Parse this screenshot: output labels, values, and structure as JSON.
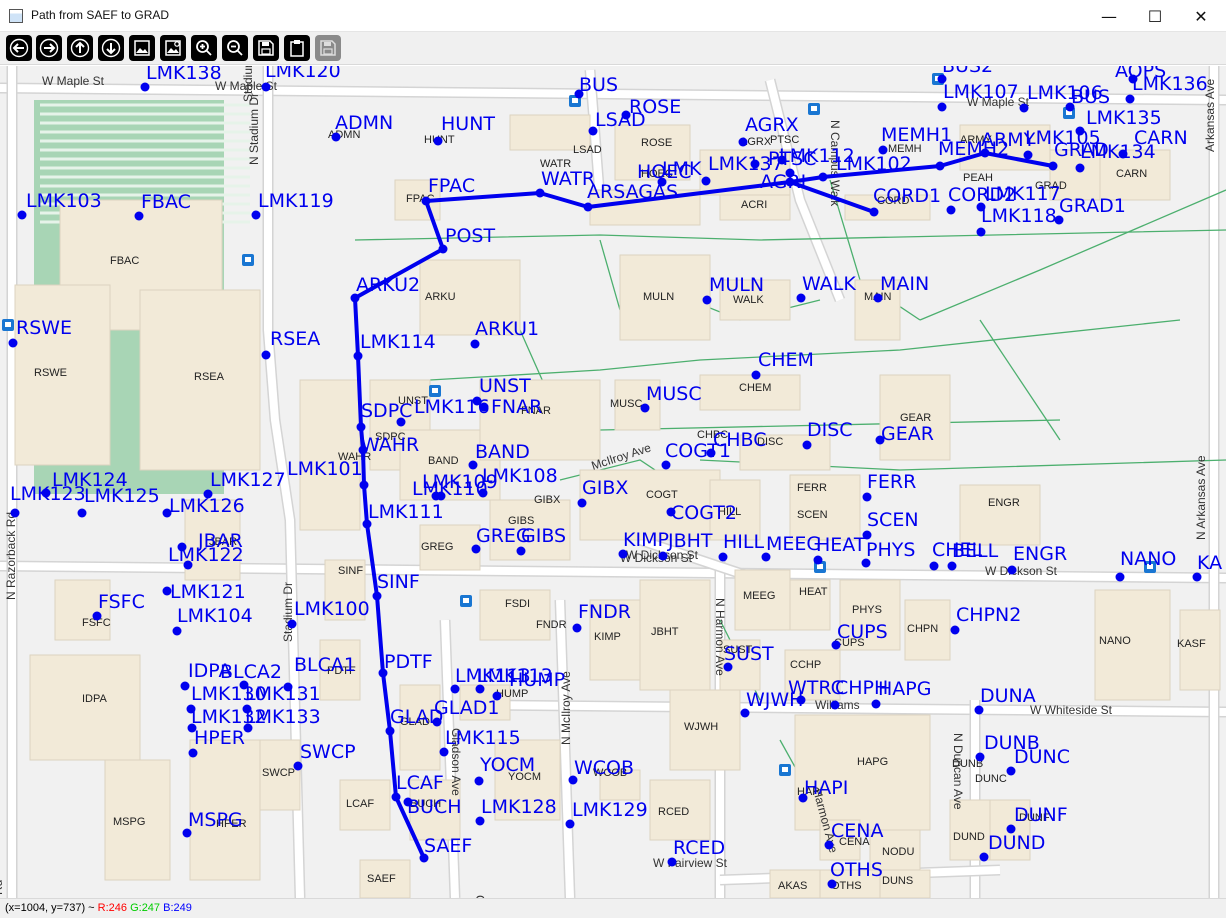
{
  "window": {
    "title": "Path from SAEF to GRAD",
    "minimize_glyph": "—",
    "maximize_glyph": "☐",
    "close_glyph": "✕"
  },
  "toolbar": [
    {
      "name": "back-button",
      "icon": "arrow-left-icon",
      "enabled": true
    },
    {
      "name": "forward-button",
      "icon": "arrow-right-icon",
      "enabled": true
    },
    {
      "name": "up-button",
      "icon": "arrow-up-icon",
      "enabled": true
    },
    {
      "name": "down-button",
      "icon": "arrow-down-icon",
      "enabled": true
    },
    {
      "name": "image-button",
      "icon": "image-icon",
      "enabled": true
    },
    {
      "name": "image-edit-button",
      "icon": "image-gear-icon",
      "enabled": true
    },
    {
      "name": "zoom-in-button",
      "icon": "zoom-in-icon",
      "enabled": true
    },
    {
      "name": "zoom-out-button",
      "icon": "zoom-out-icon",
      "enabled": true
    },
    {
      "name": "save-button",
      "icon": "floppy-disk-icon",
      "enabled": true
    },
    {
      "name": "clipboard-button",
      "icon": "clipboard-icon",
      "enabled": true
    },
    {
      "name": "save-disabled-button",
      "icon": "floppy-disk-icon",
      "enabled": false
    }
  ],
  "status": {
    "coords": "(x=1004, y=737) ~ ",
    "r": "R:246",
    "g": "G:247",
    "b": "B:249",
    "r_color": "#ff0000",
    "g_color": "#00cc00",
    "b_color": "#0000ff"
  },
  "map": {
    "node_color": "#0000ee",
    "path_color": "#0000ee",
    "nodes": [
      {
        "id": "LMK138",
        "label": "LMK138"
      },
      {
        "id": "LMK120",
        "label": "LMK120"
      },
      {
        "id": "BUS",
        "label": "BUS"
      },
      {
        "id": "ROSE",
        "label": "ROSE"
      },
      {
        "id": "BUS2",
        "label": "BUS2"
      },
      {
        "id": "AOPS",
        "label": "AOPS"
      },
      {
        "id": "LMK136",
        "label": "LMK136"
      },
      {
        "id": "LMK107",
        "label": "LMK107"
      },
      {
        "id": "LMK106",
        "label": "LMK106"
      },
      {
        "id": "BUS1",
        "label": "BUS"
      },
      {
        "id": "LMK135",
        "label": "LMK135"
      },
      {
        "id": "ADMN",
        "label": "ADMN"
      },
      {
        "id": "HUNT",
        "label": "HUNT"
      },
      {
        "id": "LSAD",
        "label": "LSAD"
      },
      {
        "id": "AGRX",
        "label": "AGRX"
      },
      {
        "id": "MEMH1",
        "label": "MEMH1"
      },
      {
        "id": "ARMY",
        "label": "ARMY"
      },
      {
        "id": "LMK105",
        "label": "LMK105"
      },
      {
        "id": "CARN",
        "label": "CARN"
      },
      {
        "id": "MEMH2",
        "label": "MEMH2"
      },
      {
        "id": "GRAD",
        "label": "GRAD"
      },
      {
        "id": "LMK134",
        "label": "LMK134"
      },
      {
        "id": "HOEC",
        "label": "HOEC"
      },
      {
        "id": "LMK115b",
        "label": "LMK"
      },
      {
        "id": "LMK137",
        "label": "LMK137"
      },
      {
        "id": "PTSC",
        "label": "PTSC"
      },
      {
        "id": "LMK112",
        "label": "LMK112"
      },
      {
        "id": "LMK102",
        "label": "LMK102"
      },
      {
        "id": "AGRI",
        "label": "AGRI"
      },
      {
        "id": "WATR",
        "label": "WATR"
      },
      {
        "id": "ARSAGAS",
        "label": "ARSAGAS"
      },
      {
        "id": "FPAC",
        "label": "FPAC"
      },
      {
        "id": "CORD1",
        "label": "CORD1"
      },
      {
        "id": "CORD2",
        "label": "CORD2"
      },
      {
        "id": "LMK117",
        "label": "LMK117"
      },
      {
        "id": "LMK118",
        "label": "LMK118"
      },
      {
        "id": "GRAD1",
        "label": "GRAD1"
      },
      {
        "id": "LMK103",
        "label": "LMK103"
      },
      {
        "id": "FBAC",
        "label": "FBAC"
      },
      {
        "id": "LMK119",
        "label": "LMK119"
      },
      {
        "id": "POST",
        "label": "POST"
      },
      {
        "id": "ARKU2",
        "label": "ARKU2"
      },
      {
        "id": "MULN",
        "label": "MULN"
      },
      {
        "id": "WALK",
        "label": "WALK"
      },
      {
        "id": "MAIN",
        "label": "MAIN"
      },
      {
        "id": "RSWE",
        "label": "RSWE"
      },
      {
        "id": "RSEA",
        "label": "RSEA"
      },
      {
        "id": "LMK114",
        "label": "LMK114"
      },
      {
        "id": "ARKU1",
        "label": "ARKU1"
      },
      {
        "id": "CHEM",
        "label": "CHEM"
      },
      {
        "id": "UNST",
        "label": "UNST"
      },
      {
        "id": "MUSC",
        "label": "MUSC"
      },
      {
        "id": "SDPC",
        "label": "SDPC"
      },
      {
        "id": "LMK116",
        "label": "LMK116"
      },
      {
        "id": "FNAR",
        "label": "FNAR"
      },
      {
        "id": "WAHR",
        "label": "WAHR"
      },
      {
        "id": "CHBC",
        "label": "CHBC"
      },
      {
        "id": "DISC",
        "label": "DISC"
      },
      {
        "id": "GEAR",
        "label": "GEAR"
      },
      {
        "id": "COGT1",
        "label": "COGT1"
      },
      {
        "id": "BAND",
        "label": "BAND"
      },
      {
        "id": "LMK108",
        "label": "LMK108"
      },
      {
        "id": "LMK101",
        "label": "LMK101"
      },
      {
        "id": "LMK109",
        "label": "LMK109"
      },
      {
        "id": "LMK110",
        "label": "LMK110"
      },
      {
        "id": "LMK124",
        "label": "LMK124"
      },
      {
        "id": "LMK127",
        "label": "LMK127"
      },
      {
        "id": "GIBX",
        "label": "GIBX"
      },
      {
        "id": "FERR",
        "label": "FERR"
      },
      {
        "id": "LMK123",
        "label": "LMK123"
      },
      {
        "id": "LMK125",
        "label": "LMK125"
      },
      {
        "id": "LMK126",
        "label": "LMK126"
      },
      {
        "id": "LMK111",
        "label": "LMK111"
      },
      {
        "id": "COGT2",
        "label": "COGT2"
      },
      {
        "id": "SCEN",
        "label": "SCEN"
      },
      {
        "id": "GREG",
        "label": "GREG"
      },
      {
        "id": "GIBS",
        "label": "GIBS"
      },
      {
        "id": "KIMP",
        "label": "KIMP"
      },
      {
        "id": "JBHT",
        "label": "JBHT"
      },
      {
        "id": "HILL",
        "label": "HILL"
      },
      {
        "id": "MEEG",
        "label": "MEEG"
      },
      {
        "id": "HEAT",
        "label": "HEAT"
      },
      {
        "id": "PHYS",
        "label": "PHYS"
      },
      {
        "id": "CHEL",
        "label": "CHEL"
      },
      {
        "id": "BELL",
        "label": "BELL"
      },
      {
        "id": "ENGR",
        "label": "ENGR"
      },
      {
        "id": "JBAR",
        "label": "JBAR"
      },
      {
        "id": "LMK122",
        "label": "LMK122"
      },
      {
        "id": "NANO",
        "label": "NANO"
      },
      {
        "id": "KASF",
        "label": "KA"
      },
      {
        "id": "SINF",
        "label": "SINF"
      },
      {
        "id": "LMK121",
        "label": "LMK121"
      },
      {
        "id": "FSFC",
        "label": "FSFC"
      },
      {
        "id": "LMK104",
        "label": "LMK104"
      },
      {
        "id": "LMK100",
        "label": "LMK100"
      },
      {
        "id": "FNDR",
        "label": "FNDR"
      },
      {
        "id": "CHPN2",
        "label": "CHPN2"
      },
      {
        "id": "CUPS",
        "label": "CUPS"
      },
      {
        "id": "SUST",
        "label": "SUST"
      },
      {
        "id": "PDTF",
        "label": "PDTF"
      },
      {
        "id": "IDPA",
        "label": "IDPA"
      },
      {
        "id": "BLCA2",
        "label": "BLCA2"
      },
      {
        "id": "BLCA1",
        "label": "BLCA1"
      },
      {
        "id": "LMK130",
        "label": "LMK130"
      },
      {
        "id": "LMK131",
        "label": "LMK131"
      },
      {
        "id": "LMK113",
        "label": "LMK113"
      },
      {
        "id": "LMK113b",
        "label": "LMK113"
      },
      {
        "id": "HUMP",
        "label": "HUMP"
      },
      {
        "id": "WJWH",
        "label": "WJWH"
      },
      {
        "id": "WTRC",
        "label": "WTRC"
      },
      {
        "id": "CHPH",
        "label": "CHPH"
      },
      {
        "id": "HAPG",
        "label": "HAPG"
      },
      {
        "id": "DUNA",
        "label": "DUNA"
      },
      {
        "id": "LMK132",
        "label": "LMK132"
      },
      {
        "id": "LMK133",
        "label": "LMK133"
      },
      {
        "id": "GLAD1",
        "label": "GLAD1"
      },
      {
        "id": "GLAD",
        "label": "GLAD"
      },
      {
        "id": "HPER",
        "label": "HPER"
      },
      {
        "id": "LMK115",
        "label": "LMK115"
      },
      {
        "id": "SWCP",
        "label": "SWCP"
      },
      {
        "id": "YOCM",
        "label": "YOCM"
      },
      {
        "id": "WCOB",
        "label": "WCOB"
      },
      {
        "id": "DUNB",
        "label": "DUNB"
      },
      {
        "id": "DUNC",
        "label": "DUNC"
      },
      {
        "id": "LCAF",
        "label": "LCAF"
      },
      {
        "id": "HAPI",
        "label": "HAPI"
      },
      {
        "id": "BUCH",
        "label": "BUCH"
      },
      {
        "id": "LMK128",
        "label": "LMK128"
      },
      {
        "id": "LMK129",
        "label": "LMK129"
      },
      {
        "id": "DUNF",
        "label": "DUNF"
      },
      {
        "id": "MSPG",
        "label": "MSPG"
      },
      {
        "id": "CENA",
        "label": "CENA"
      },
      {
        "id": "DUND",
        "label": "DUND"
      },
      {
        "id": "SAEF",
        "label": "SAEF"
      },
      {
        "id": "RCED",
        "label": "RCED"
      },
      {
        "id": "OTHS",
        "label": "OTHS"
      }
    ],
    "path": [
      "SAEF",
      "LCAF",
      "GLAD",
      "PDTF",
      "SINF",
      "LMK111",
      "LMK101",
      "WAHR",
      "SDPC",
      "LMK114",
      "ARKU2",
      "POST",
      "FPAC",
      "WATR",
      "ARSAGAS",
      "AGRI",
      "CORD1",
      "AGRI",
      "LMK102",
      "MEMH2",
      "ARMY",
      "GRAD"
    ],
    "buildings": [
      "ADMN",
      "HUNT",
      "LSAD",
      "ROSE",
      "WATR",
      "HOEC",
      "AGRX",
      "PTSC",
      "MEMH",
      "ARMY",
      "PEAH",
      "GRAD",
      "CARN",
      "FPAC",
      "CORD",
      "ACRI",
      "FBAC",
      "ARKU",
      "MULN",
      "WALK",
      "MAIN",
      "RSWE",
      "RSEA",
      "CHEM",
      "UNST",
      "FNAR",
      "MUSC",
      "GEAR",
      "SDPC",
      "WAHR",
      "BAND",
      "CHBC",
      "DISC",
      "GIBX",
      "COGT",
      "FERR",
      "SCEN",
      "ENGR",
      "GREG",
      "GIBS",
      "HILL",
      "JBAR",
      "SINF",
      "FSDI",
      "FNDR",
      "KIMP",
      "JBHT",
      "MEEG",
      "HEAT",
      "PHYS",
      "CHPN",
      "NANO",
      "KASF",
      "FSFC",
      "IDPA",
      "PDTF",
      "SUST",
      "CUPS",
      "CCHP",
      "HUMP",
      "GLAD",
      "WJWH",
      "HAPG",
      "SWCP",
      "YOCM",
      "WCOB",
      "DUNB",
      "DUNC",
      "MSPG",
      "HPER",
      "LCAF",
      "BUCH",
      "RCED",
      "CENA",
      "NODU",
      "DUND",
      "DUNF",
      "SAEF",
      "AKAS",
      "OTHS",
      "DUNS",
      "HAPI"
    ],
    "streets": [
      "W Maple St",
      "W Maple St",
      "W Maple St",
      "N Stadium Dr",
      "Stadium Dr",
      "N Razorback Rd",
      "Stadium Dr",
      "W Dickson St",
      "W Dickson St",
      "W Dickson St",
      "N Harmon Ave",
      "Williams",
      "W Whiteside St",
      "Arkansas Ave",
      "N Arkansas Ave",
      "McIlroy Ave",
      "N McIlroy Ave",
      "W Fairview St",
      "N Duncan Ave",
      "Harmon Ave",
      "N Campus Walk",
      "Gladson Ave",
      "Rd",
      "Oa"
    ]
  }
}
